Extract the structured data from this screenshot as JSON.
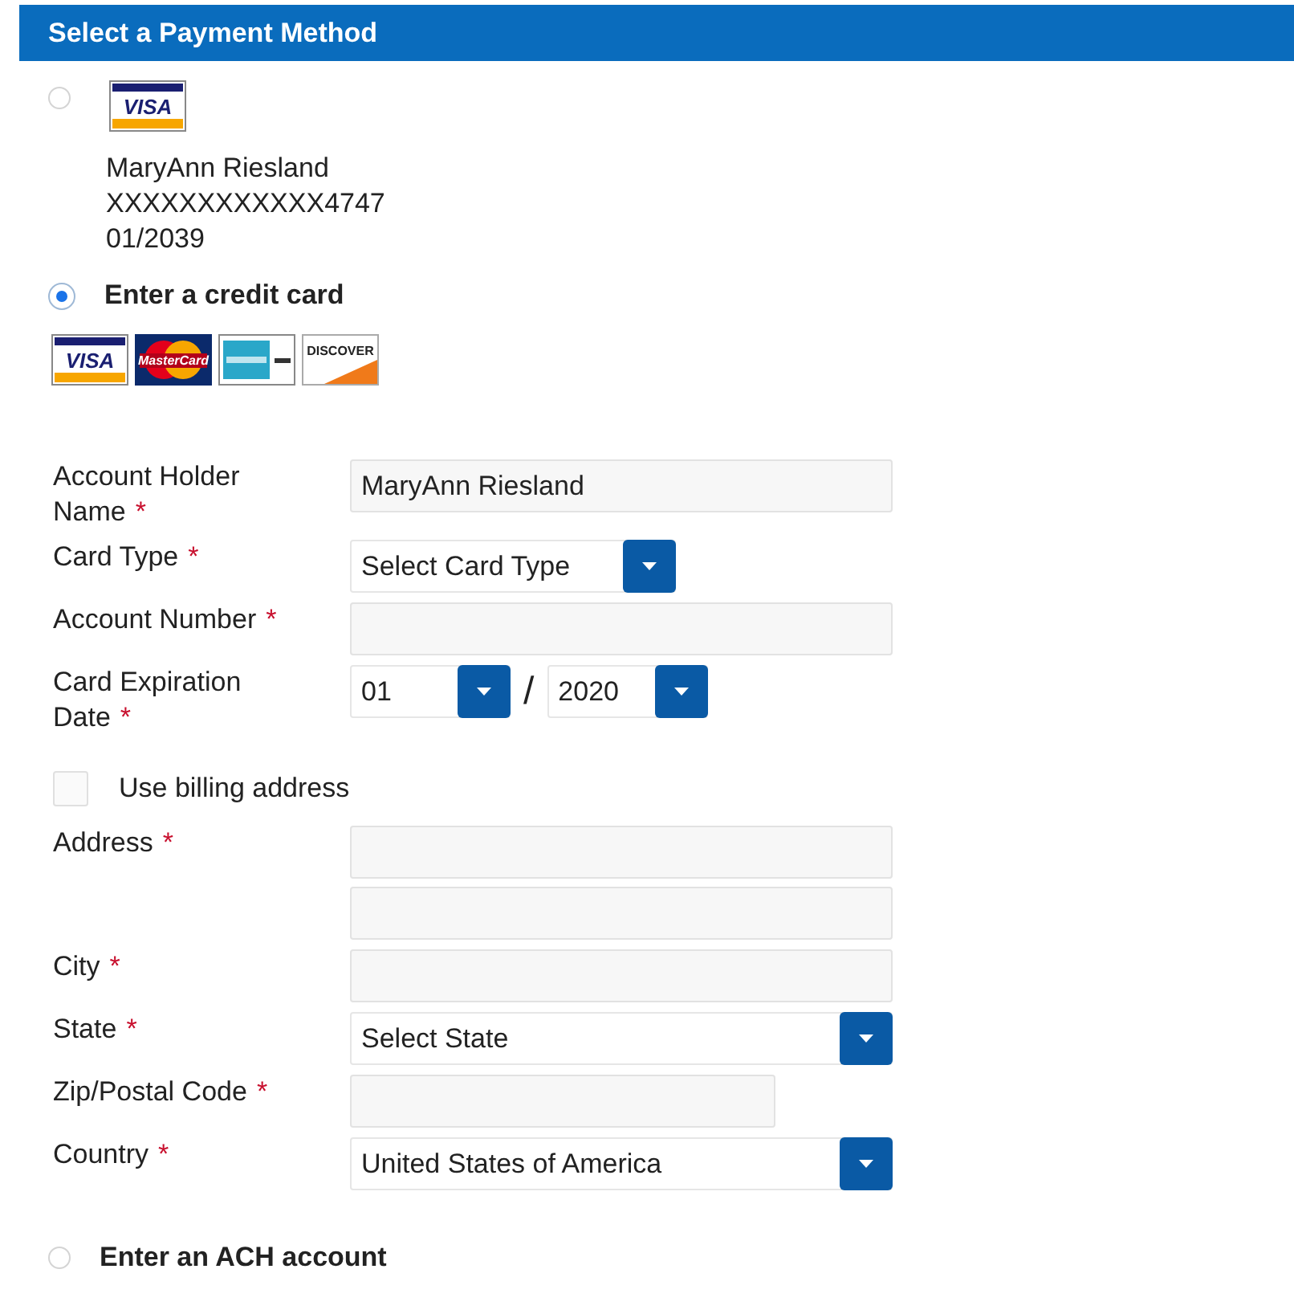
{
  "header": {
    "title": "Select a Payment Method"
  },
  "payment_options": [
    {
      "kind": "saved_card",
      "selected": false,
      "card_logo": {
        "kind": "visa",
        "text": "VISA"
      },
      "lines": [
        "MaryAnn Riesland",
        "XXXXXXXXXXXX4747",
        "01/2039"
      ]
    },
    {
      "kind": "new_card",
      "selected": true,
      "label": "Enter a credit card",
      "card_logos": [
        {
          "kind": "visa",
          "text": "VISA"
        },
        {
          "kind": "mastercard",
          "text": "MasterCard"
        },
        {
          "kind": "amex"
        },
        {
          "kind": "discover",
          "text": "DISCOVER"
        }
      ],
      "fields": [
        {
          "kind": "text",
          "label": "Account Holder Name",
          "required_mark": "*",
          "value": "MaryAnn Riesland"
        },
        {
          "kind": "select_short",
          "label": "Card Type",
          "required_mark": "*",
          "value": "Select Card Type"
        },
        {
          "kind": "text",
          "label": "Account Number",
          "required_mark": "*"
        },
        {
          "kind": "date",
          "label": "Card Expiration Date",
          "required_mark": "*",
          "month": "01",
          "separator": "/",
          "year": "2020"
        },
        {
          "kind": "checkbox",
          "label": "Use billing address",
          "checked": false
        },
        {
          "kind": "text_double",
          "label": "Address",
          "required_mark": "*"
        },
        {
          "kind": "text",
          "label": "City",
          "required_mark": "*"
        },
        {
          "kind": "select",
          "label": "State",
          "required_mark": "*",
          "value": "Select State"
        },
        {
          "kind": "text_short",
          "label": "Zip/Postal Code",
          "required_mark": "*"
        },
        {
          "kind": "select",
          "label": "Country",
          "required_mark": "*",
          "value": "United States of America"
        }
      ]
    },
    {
      "kind": "ach",
      "selected": false,
      "label": "Enter an ACH account"
    }
  ]
}
